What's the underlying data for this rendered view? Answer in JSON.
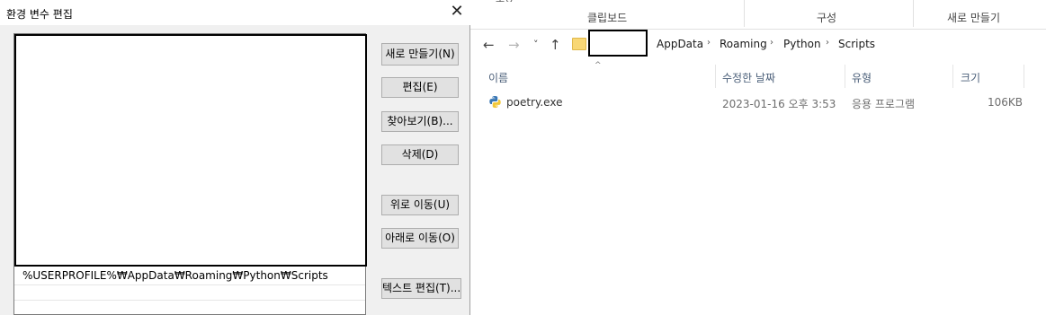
{
  "dialog": {
    "title": "환경 변수 편집",
    "close_glyph": "✕",
    "list_items": [
      "%USERPROFILE%₩AppData₩Roaming₩Python₩Scripts"
    ],
    "buttons": {
      "new": "새로 만들기(N)",
      "edit": "편집(E)",
      "browse": "찾아보기(B)...",
      "delete": "삭제(D)",
      "move_up": "위로 이동(U)",
      "move_down": "아래로 이동(O)",
      "edit_text": "텍스트 편집(T)..."
    }
  },
  "explorer": {
    "ribbon_groups": [
      "클립보드",
      "구성",
      "새로 만들기"
    ],
    "nav": {
      "back": "←",
      "forward": "→",
      "recent": "˅",
      "up": "↑"
    },
    "breadcrumb": [
      "AppData",
      "Roaming",
      "Python",
      "Scripts"
    ],
    "breadcrumb_separator": "›",
    "columns": [
      "이름",
      "수정한 날짜",
      "유형",
      "크기"
    ],
    "files": [
      {
        "name": "poetry.exe",
        "modified": "2023-01-16 오후 3:53",
        "type": "응용 프로그램",
        "size": "106KB",
        "icon": "python-icon"
      }
    ],
    "sort_indicator": "^"
  }
}
